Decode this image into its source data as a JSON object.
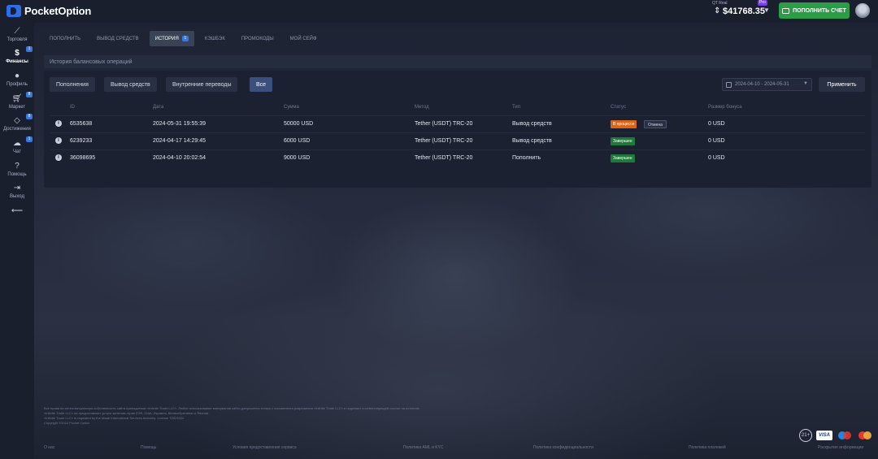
{
  "header": {
    "logo_text": "PocketOption",
    "account_label": "QT Real",
    "pro_badge": "Pro",
    "balance": "$41768.35",
    "deposit_button": "ПОПОЛНИТЬ СЧЕТ"
  },
  "sidebar": {
    "items": [
      {
        "label": "Торговля",
        "icon": "chart-line-icon"
      },
      {
        "label": "Финансы",
        "icon": "dollar-icon",
        "badge": "1"
      },
      {
        "label": "Профиль",
        "icon": "user-icon"
      },
      {
        "label": "Маркет",
        "icon": "cart-icon",
        "badge": "8"
      },
      {
        "label": "Достижения",
        "icon": "diamond-icon",
        "badge": "8"
      },
      {
        "label": "Чат",
        "icon": "chat-icon",
        "badge": "1"
      },
      {
        "label": "Помощь",
        "icon": "help-icon"
      },
      {
        "label": "Выход",
        "icon": "logout-icon"
      }
    ]
  },
  "tabs": [
    {
      "label": "ПОПОЛНИТЬ"
    },
    {
      "label": "ВЫВОД СРЕДСТВ"
    },
    {
      "label": "ИСТОРИЯ",
      "badge": "1"
    },
    {
      "label": "КЭШБЭК"
    },
    {
      "label": "ПРОМОКОДЫ"
    },
    {
      "label": "МОЙ СЕЙФ"
    }
  ],
  "subtitle": "История балансовых операций",
  "filters": {
    "deposits": "Пополнения",
    "withdrawals": "Вывод средств",
    "transfers": "Внутренние переводы",
    "all": "Все"
  },
  "date_range": "2024-04-10 - 2024-05-31",
  "apply_button": "Применить",
  "table": {
    "headers": {
      "id": "ID",
      "date": "Дата",
      "amount": "Сумма",
      "method": "Метод",
      "type": "Тип",
      "status": "Статус",
      "bonus": "Размер бонуса"
    },
    "rows": [
      {
        "id": "6535638",
        "date": "2024-05-31 19:55:39",
        "amount": "50000 USD",
        "method": "Tether (USDT) TRC-20",
        "type": "Вывод средств",
        "status": "В процессе",
        "action": "Отмена",
        "bonus": "0 USD"
      },
      {
        "id": "6239233",
        "date": "2024-04-17 14:29:45",
        "amount": "6000 USD",
        "method": "Tether (USDT) TRC-20",
        "type": "Вывод средств",
        "status": "Завершен",
        "bonus": "0 USD"
      },
      {
        "id": "36098695",
        "date": "2024-04-10 20:02:54",
        "amount": "9000 USD",
        "method": "Tether (USDT) TRC-20",
        "type": "Пополнить",
        "status": "Завершен",
        "bonus": "0 USD"
      }
    ]
  },
  "footer": {
    "disclaimer_1": "Все права на интеллектуальную собственность сайта принадлежат «Infinite Trade LLC». Любое использование материалов сайта допускается только с письменного разрешения «Infinite Trade LLC» и подлежит соответствующей ссылке на источник.",
    "disclaimer_2": "«Infinite Trade LLC» не предоставляет услуги жителям стран ЕЭЗ, США, Израиля, Великобритании и Японии.",
    "disclaimer_3": "«Infinite Trade LLC» is regulated by the Mwali International Services Authority. License T2023322.",
    "disclaimer_4": "Copyright ©2024 Pocket Option",
    "links": [
      "О нас",
      "Помощь",
      "Условия предоставления сервиса",
      "Политика AML и KYC",
      "Политика конфиденциальности",
      "Политика платежей",
      "Раскрытие информации"
    ],
    "age_label": "21+",
    "visa_label": "VISA"
  }
}
